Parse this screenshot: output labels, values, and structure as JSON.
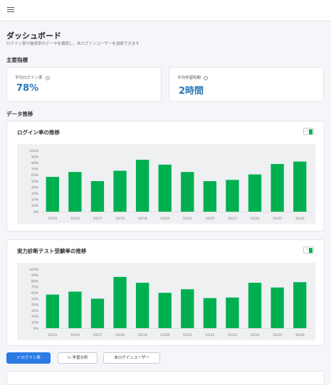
{
  "header": {
    "menu_icon": "hamburger-menu-icon"
  },
  "page": {
    "title": "ダッシュボード",
    "subtitle": "ログイン率や継続率のデータを確認し、未ログインユーザーを追跡できます"
  },
  "sections": {
    "key_metrics": "主要指標",
    "data_trends": "データ推移"
  },
  "metrics": [
    {
      "label": "平均ログイン率",
      "value": "78%",
      "icon": "info-icon"
    },
    {
      "label": "平均学習時間",
      "value": "2時間",
      "icon": "info-icon"
    }
  ],
  "chart_toggle_icons": [
    "line-chart-icon",
    "bar-chart-icon"
  ],
  "colors": {
    "accent": "#2c7be5",
    "bar": "#00b050",
    "metric_value": "#2a78b8"
  },
  "chart_data": [
    {
      "type": "bar",
      "title": "ログイン率の推移",
      "categories": [
        "10/15",
        "10/16",
        "10/17",
        "10/18",
        "10/19",
        "10/20",
        "10/21",
        "10/22",
        "10/23",
        "10/24",
        "10/25",
        "10/26"
      ],
      "series": [
        {
          "values": [
            57,
            65,
            50,
            67,
            85,
            77,
            65,
            50,
            52,
            61,
            78,
            82
          ]
        }
      ],
      "yticks": [
        "100%",
        "90%",
        "80%",
        "70%",
        "60%",
        "50%",
        "40%",
        "30%",
        "20%",
        "10%",
        "0%"
      ],
      "ylim": [
        0,
        100
      ],
      "grid": false
    },
    {
      "type": "bar",
      "title": "実力診断テスト受験率の推移",
      "categories": [
        "10/15",
        "10/16",
        "10/17",
        "10/18",
        "10/19",
        "10/20",
        "10/21",
        "10/22",
        "10/23",
        "10/24",
        "10/25",
        "10/26"
      ],
      "series": [
        {
          "values": [
            57,
            62,
            50,
            87,
            77,
            60,
            66,
            51,
            52,
            77,
            69,
            78
          ]
        }
      ],
      "yticks": [
        "100%",
        "90%",
        "80%",
        "70%",
        "60%",
        "50%",
        "40%",
        "30%",
        "20%",
        "10%",
        "0%"
      ],
      "ylim": [
        0,
        100
      ],
      "grid": false
    }
  ],
  "bottom_buttons": [
    {
      "label": "ログイン率",
      "icon": "trend-icon",
      "active": true
    },
    {
      "label": "学習分析",
      "icon": "book-icon",
      "active": false
    },
    {
      "label": "未ログインユーザー",
      "icon": "",
      "active": false
    }
  ]
}
